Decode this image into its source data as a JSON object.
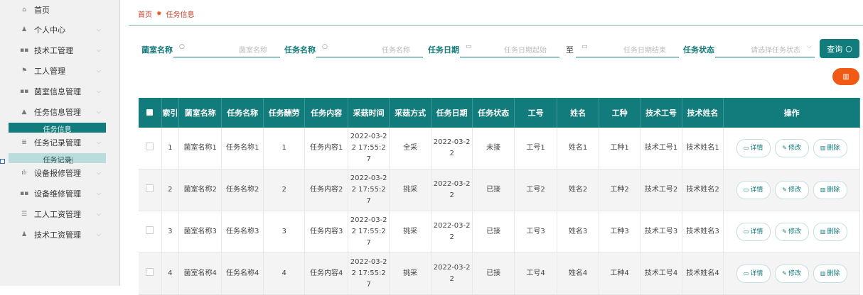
{
  "sidebar": {
    "items": [
      {
        "icon": "⌂",
        "label": "首页",
        "chevron": false
      },
      {
        "icon": "♟",
        "label": "个人中心",
        "chevron": true
      },
      {
        "icon": "▪▪",
        "label": "技术工管理",
        "chevron": true
      },
      {
        "icon": "⚑",
        "label": "工人管理",
        "chevron": true
      },
      {
        "icon": "▪▪",
        "label": "菌室信息管理",
        "chevron": true
      },
      {
        "icon": "▲",
        "label": "任务信息管理",
        "chevron": true
      },
      {
        "icon": "≣",
        "label": "任务记录管理",
        "chevron": true
      },
      {
        "icon": "ılı",
        "label": "设备报修管理",
        "chevron": true
      },
      {
        "icon": "▪▪",
        "label": "设备维修管理",
        "chevron": true
      },
      {
        "icon": "☰",
        "label": "工人工资管理",
        "chevron": true
      },
      {
        "icon": "♟",
        "label": "技术工资管理",
        "chevron": true
      }
    ],
    "sub_active": "任务信息",
    "sub_hover": "任务记录"
  },
  "breadcrumb": {
    "home": "首页",
    "sep": "✹",
    "current": "任务信息"
  },
  "filters": {
    "room_label": "菌室名称",
    "room_placeholder": "菌室名称",
    "task_label": "任务名称",
    "task_placeholder": "任务名称",
    "date_label": "任务日期",
    "date_start_placeholder": "任务日期起始",
    "to": "至",
    "date_end_placeholder": "任务日期结束",
    "status_label": "任务状态",
    "status_placeholder": "请选择任务状态",
    "search_button": "查询",
    "delete_icon": "trash-icon"
  },
  "table": {
    "columns": [
      "",
      "索引",
      "菌室名称",
      "任务名称",
      "任务酬劳",
      "任务内容",
      "采菇时间",
      "采菇方式",
      "任务日期",
      "任务状态",
      "工号",
      "姓名",
      "工种",
      "技术工号",
      "技术姓名",
      "操作"
    ],
    "rows": [
      [
        "1",
        "菌室名称1",
        "任务名称1",
        "1",
        "任务内容1",
        "2022-03-22 17:55:27",
        "全采",
        "2022-03-22",
        "未接",
        "工号1",
        "姓名1",
        "工种1",
        "技术工号1",
        "技术姓名1"
      ],
      [
        "2",
        "菌室名称2",
        "任务名称2",
        "2",
        "任务内容2",
        "2022-03-22 17:55:27",
        "挑采",
        "2022-03-22",
        "已接",
        "工号2",
        "姓名2",
        "工种2",
        "技术工号2",
        "技术姓名2"
      ],
      [
        "3",
        "菌室名称3",
        "任务名称3",
        "3",
        "任务内容3",
        "2022-03-22 17:55:27",
        "挑采",
        "2022-03-22",
        "已接",
        "工号3",
        "姓名3",
        "工种3",
        "技术工号3",
        "技术姓名3"
      ],
      [
        "4",
        "菌室名称4",
        "任务名称4",
        "4",
        "任务内容4",
        "2022-03-22 17:55:27",
        "挑采",
        "2022-03-22",
        "已接",
        "工号4",
        "姓名4",
        "工种4",
        "技术工号4",
        "技术姓名4"
      ]
    ],
    "actions": {
      "detail": "详情",
      "edit": "修改",
      "delete": "删除"
    }
  },
  "colors": {
    "primary": "#127b7b",
    "danger": "#f05a14",
    "breadcrumb": "#c53f2a"
  }
}
